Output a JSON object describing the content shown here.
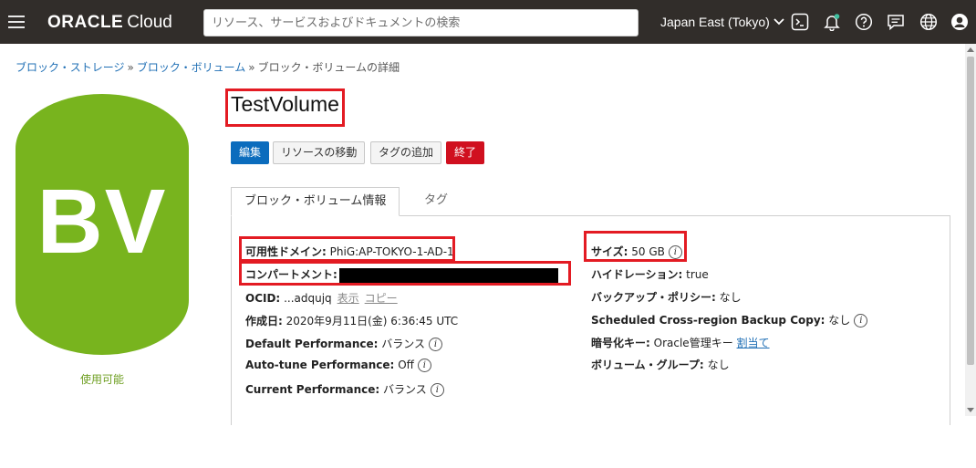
{
  "header": {
    "brand": "ORACLE",
    "brand_suffix": "Cloud",
    "search_placeholder": "リソース、サービスおよびドキュメントの検索",
    "region": "Japan East (Tokyo)",
    "icons": [
      "menu-icon",
      "cloud-shell-icon",
      "bell-icon",
      "help-icon",
      "chat-icon",
      "globe-icon",
      "user-icon"
    ]
  },
  "breadcrumb": {
    "items": [
      "ブロック・ストレージ",
      "ブロック・ボリューム",
      "ブロック・ボリュームの詳細"
    ],
    "separator": "»"
  },
  "badge": {
    "text": "BV",
    "status": "使用可能",
    "color": "#78b41e"
  },
  "title": "TestVolume",
  "actions": {
    "edit": "編集",
    "move": "リソースの移動",
    "add_tags": "タグの追加",
    "terminate": "終了"
  },
  "tabs": {
    "info": "ブロック・ボリューム情報",
    "tags": "タグ"
  },
  "details_left": {
    "ad_label": "可用性ドメイン:",
    "ad_value": "PhiG:AP-TOKYO-1-AD-1",
    "compartment_label": "コンパートメント:",
    "ocid_label": "OCID:",
    "ocid_value": "...adqujq",
    "ocid_show": "表示",
    "ocid_copy": "コピー",
    "created_label": "作成日:",
    "created_value": "2020年9月11日(金) 6:36:45 UTC",
    "default_perf_label": "Default Performance:",
    "default_perf_value": "バランス",
    "autotune_label": "Auto-tune Performance:",
    "autotune_value": "Off",
    "current_perf_label": "Current Performance:",
    "current_perf_value": "バランス"
  },
  "details_right": {
    "size_label": "サイズ:",
    "size_value": "50 GB",
    "hydration_label": "ハイドレーション:",
    "hydration_value": "true",
    "backup_label": "バックアップ・ポリシー:",
    "backup_value": "なし",
    "crb_label": "Scheduled Cross-region Backup Copy:",
    "crb_value": "なし",
    "encryption_label": "暗号化キー:",
    "encryption_value": "Oracle管理キー",
    "encryption_link": "割当て",
    "vg_label": "ボリューム・グループ:",
    "vg_value": "なし"
  },
  "info_glyph": "i",
  "colors": {
    "header_bg": "#312d2a",
    "accent": "#0b6cbd",
    "danger": "#d0101f",
    "highlight": "#e31b23"
  }
}
